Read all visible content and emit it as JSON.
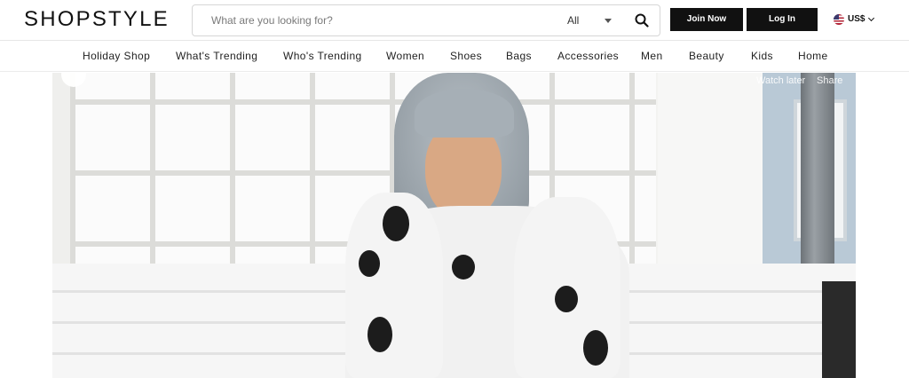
{
  "header": {
    "logo": "SHOPSTYLE",
    "search": {
      "placeholder": "What are you looking for?",
      "value": "",
      "category": "All"
    },
    "join_label": "Join Now",
    "login_label": "Log In",
    "currency_label": "US$"
  },
  "nav": {
    "items": [
      "Holiday Shop",
      "What's Trending",
      "Who's Trending",
      "Women",
      "Shoes",
      "Bags",
      "Accessories",
      "Men",
      "Beauty",
      "Kids",
      "Home"
    ]
  },
  "video": {
    "watch_later_label": "Watch later",
    "share_label": "Share"
  },
  "colors": {
    "button_bg": "#111111",
    "text": "#111111"
  },
  "icons": [
    "search-icon",
    "chevron-down-icon",
    "us-flag-icon"
  ]
}
